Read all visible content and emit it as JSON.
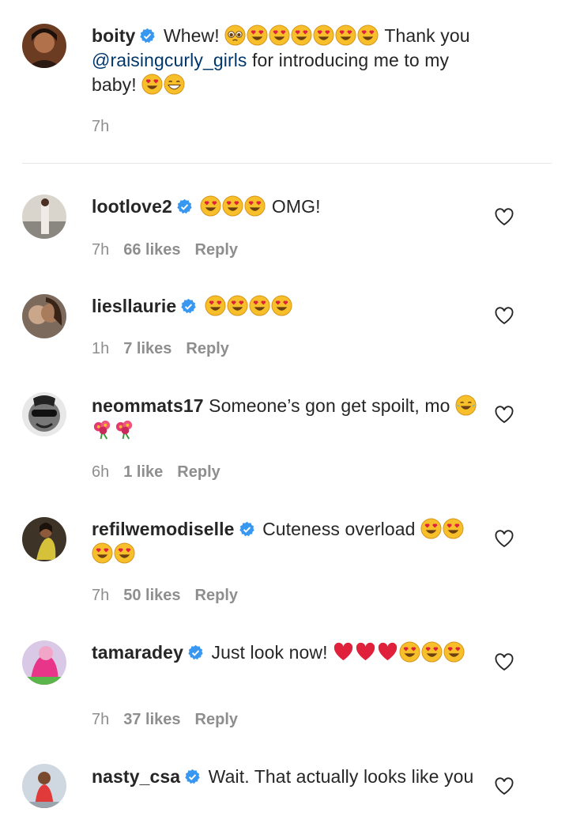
{
  "caption": {
    "username": "boity",
    "verified": true,
    "text_before": "Whew!",
    "text_mid": "Thank you",
    "mention": "@raisingcurly_girls",
    "text_after": "for introducing me to my baby!",
    "time": "7h"
  },
  "comments": [
    {
      "username": "lootlove2",
      "verified": true,
      "text": "OMG!",
      "time": "7h",
      "likes": "66 likes",
      "reply": "Reply"
    },
    {
      "username": "liesllaurie",
      "verified": true,
      "text": "",
      "time": "1h",
      "likes": "7 likes",
      "reply": "Reply"
    },
    {
      "username": "neommats17",
      "verified": false,
      "text": "Someone’s gon get spoilt, mo",
      "time": "6h",
      "likes": "1 like",
      "reply": "Reply"
    },
    {
      "username": "refilwemodiselle",
      "verified": true,
      "text": "Cuteness overload",
      "time": "7h",
      "likes": "50 likes",
      "reply": "Reply"
    },
    {
      "username": "tamaradey",
      "verified": true,
      "text": "Just look now!",
      "time": "7h",
      "likes": "37 likes",
      "reply": "Reply"
    },
    {
      "username": "nasty_csa",
      "verified": true,
      "text": "Wait. That actually looks like you",
      "time": "",
      "likes": "",
      "reply": ""
    }
  ],
  "colors": {
    "verified": "#3897f0",
    "mention": "#00376b",
    "meta": "#8e8e8e",
    "emoji_face": "#f7c02b",
    "heart_eyes": "#e0213b"
  },
  "icons": {
    "like": "heart-outline-icon",
    "verified": "verified-badge-icon"
  }
}
